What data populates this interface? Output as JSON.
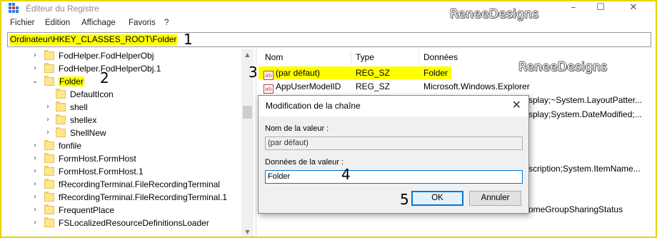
{
  "window": {
    "title": "Éditeur du Registre",
    "watermark": "ReneeDesigns",
    "minimize": "–",
    "maximize": "☐",
    "close": "✕"
  },
  "menu": [
    "Fichier",
    "Edition",
    "Affichage",
    "Favoris",
    "?"
  ],
  "address": {
    "path": "Ordinateur\\HKEY_CLASSES_ROOT\\Folder"
  },
  "annotations": [
    "1",
    "2",
    "3",
    "4",
    "5"
  ],
  "tree": {
    "items": [
      {
        "label": "FodHelper.FodHelperObj",
        "expander": "›"
      },
      {
        "label": "FodHelper.FodHelperObj.1",
        "expander": "›"
      },
      {
        "label": "Folder",
        "expander": "⌄"
      },
      {
        "label": "DefaultIcon",
        "expander": ""
      },
      {
        "label": "shell",
        "expander": "›"
      },
      {
        "label": "shellex",
        "expander": "›"
      },
      {
        "label": "ShellNew",
        "expander": "›"
      },
      {
        "label": "fonfile",
        "expander": "›"
      },
      {
        "label": "FormHost.FormHost",
        "expander": "›"
      },
      {
        "label": "FormHost.FormHost.1",
        "expander": "›"
      },
      {
        "label": "fRecordingTerminal.FileRecordingTerminal",
        "expander": "›"
      },
      {
        "label": "fRecordingTerminal.FileRecordingTerminal.1",
        "expander": "›"
      },
      {
        "label": "FrequentPlace",
        "expander": "›"
      },
      {
        "label": "FSLocalizedResourceDefinitionsLoader",
        "expander": "›"
      }
    ]
  },
  "scrollbar": {
    "up": "▲",
    "down": "▼"
  },
  "values": {
    "columns": [
      "Nom",
      "Type",
      "Données"
    ],
    "icon_text": "ab",
    "rows": [
      {
        "name": "(par défaut)",
        "type": "REG_SZ",
        "data": "Folder"
      },
      {
        "name": "AppUserModelID",
        "type": "REG_SZ",
        "data": "Microsoft.Windows.Explorer"
      }
    ],
    "partial_data": [
      "splay;~System.LayoutPatter...",
      "splay;System.DateModified;...",
      "scription;System.ItemName...",
      "omeGroupSharingStatus"
    ]
  },
  "dialog": {
    "title": "Modification de la chaîne",
    "close": "✕",
    "name_label": "Nom de la valeur :",
    "name_value": "(par défaut)",
    "data_label": "Données de la valeur :",
    "data_value": "Folder",
    "ok": "OK",
    "cancel": "Annuler"
  }
}
